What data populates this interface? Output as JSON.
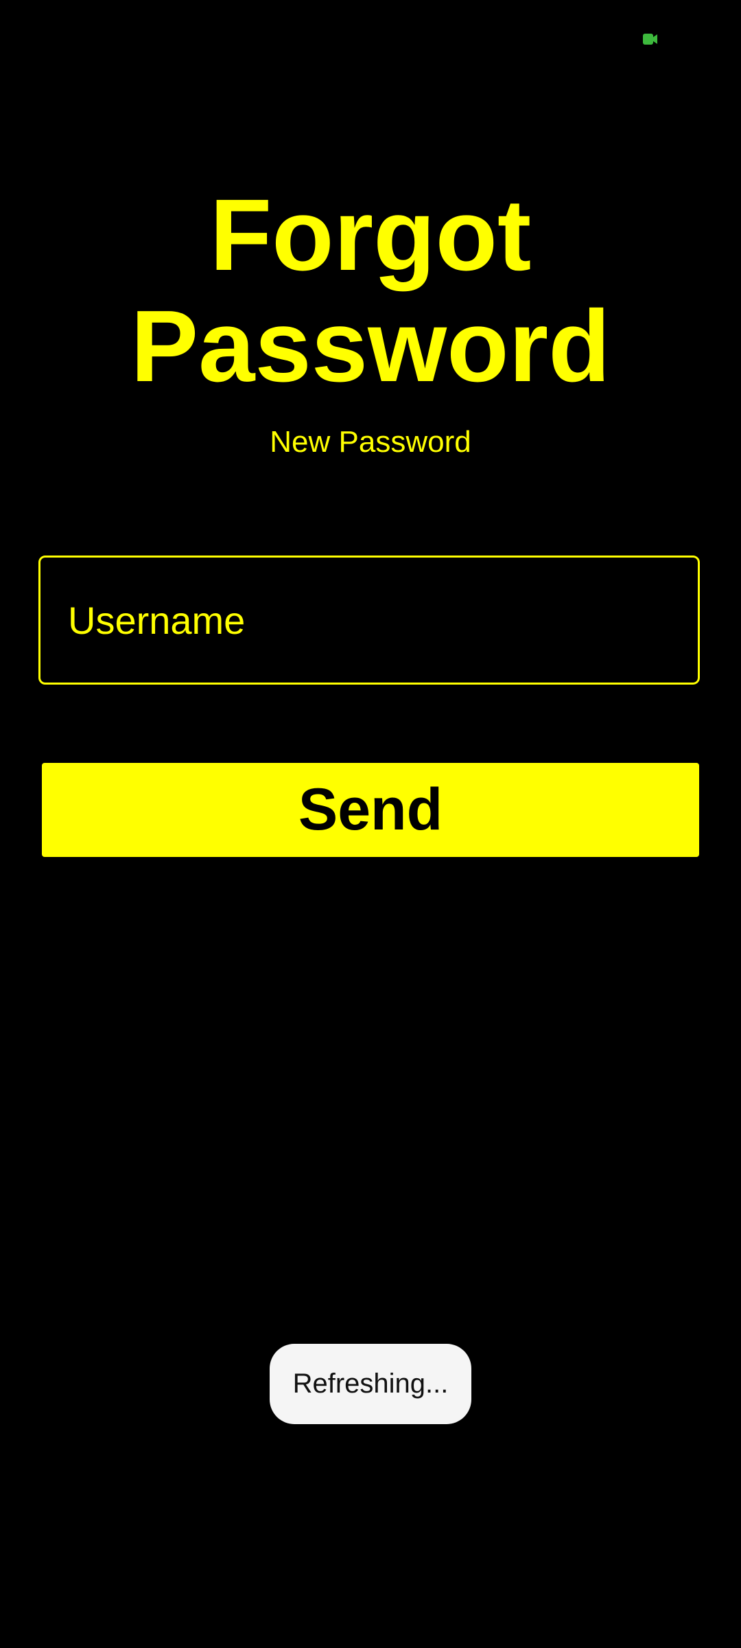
{
  "status_bar": {
    "indicator_icon": "camera-in-use-icon",
    "indicator_color": "#3DB93D"
  },
  "screen": {
    "title": "Forgot Password",
    "subtitle": "New Password",
    "accent_color": "#FFFF00",
    "background_color": "#000000"
  },
  "form": {
    "username_placeholder": "Username",
    "username_value": "",
    "send_label": "Send"
  },
  "toast": {
    "message": "Refreshing..."
  }
}
